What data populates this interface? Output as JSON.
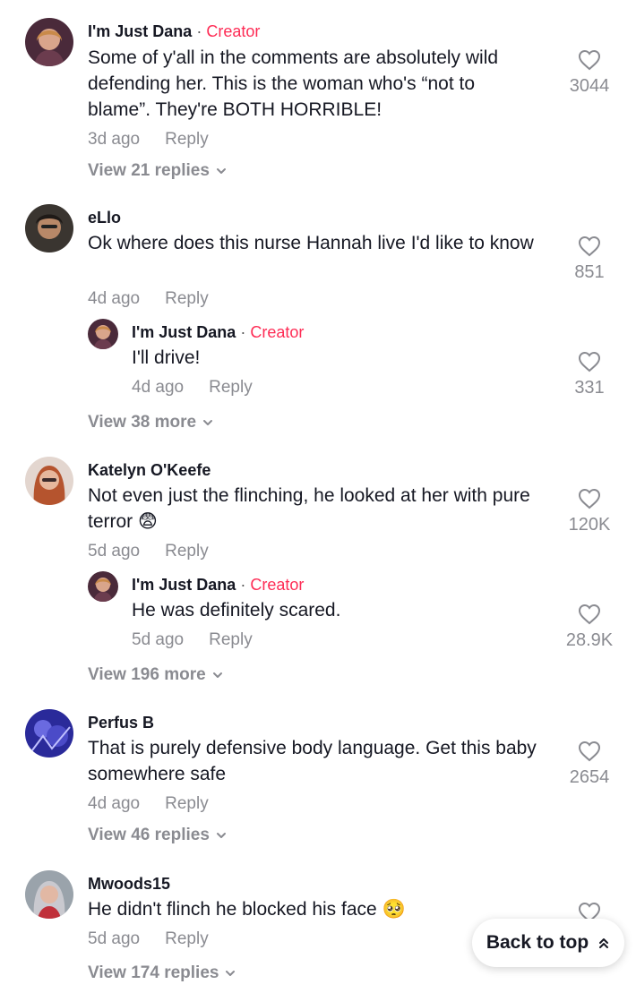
{
  "comments": [
    {
      "username": "I'm Just Dana",
      "creator_label": "Creator",
      "text": "Some of y'all in the comments are absolutely wild defending her. This is the woman who's “not to blame”. They're BOTH HORRIBLE!",
      "time": "3d ago",
      "reply_label": "Reply",
      "likes": "3044",
      "view_label": "View 21 replies"
    },
    {
      "username": "eLlo",
      "text": "Ok where does this nurse Hannah live I'd like to know",
      "time": "4d ago",
      "reply_label": "Reply",
      "likes": "851",
      "reply": {
        "username": "I'm Just Dana",
        "creator_label": "Creator",
        "text": "I'll drive!",
        "time": "4d ago",
        "reply_label": "Reply",
        "likes": "331"
      },
      "view_label": "View 38 more"
    },
    {
      "username": "Katelyn O'Keefe",
      "text": "Not even just the flinching, he looked at her with pure terror 😨",
      "time": "5d ago",
      "reply_label": "Reply",
      "likes": "120K",
      "reply": {
        "username": "I'm Just Dana",
        "creator_label": "Creator",
        "text": "He was definitely scared.",
        "time": "5d ago",
        "reply_label": "Reply",
        "likes": "28.9K"
      },
      "view_label": "View 196 more"
    },
    {
      "username": "Perfus B",
      "text": "That is purely defensive body language. Get this baby somewhere safe",
      "time": "4d ago",
      "reply_label": "Reply",
      "likes": "2654",
      "view_label": "View 46 replies"
    },
    {
      "username": "Mwoods15",
      "text": "He didn't flinch he blocked his face 🥺",
      "time": "5d ago",
      "reply_label": "Reply",
      "view_label": "View 174 replies"
    }
  ],
  "back_to_top": "Back to top",
  "colors": {
    "creator": "#fe2c55",
    "muted": "#8a8b91",
    "text": "#161823"
  }
}
